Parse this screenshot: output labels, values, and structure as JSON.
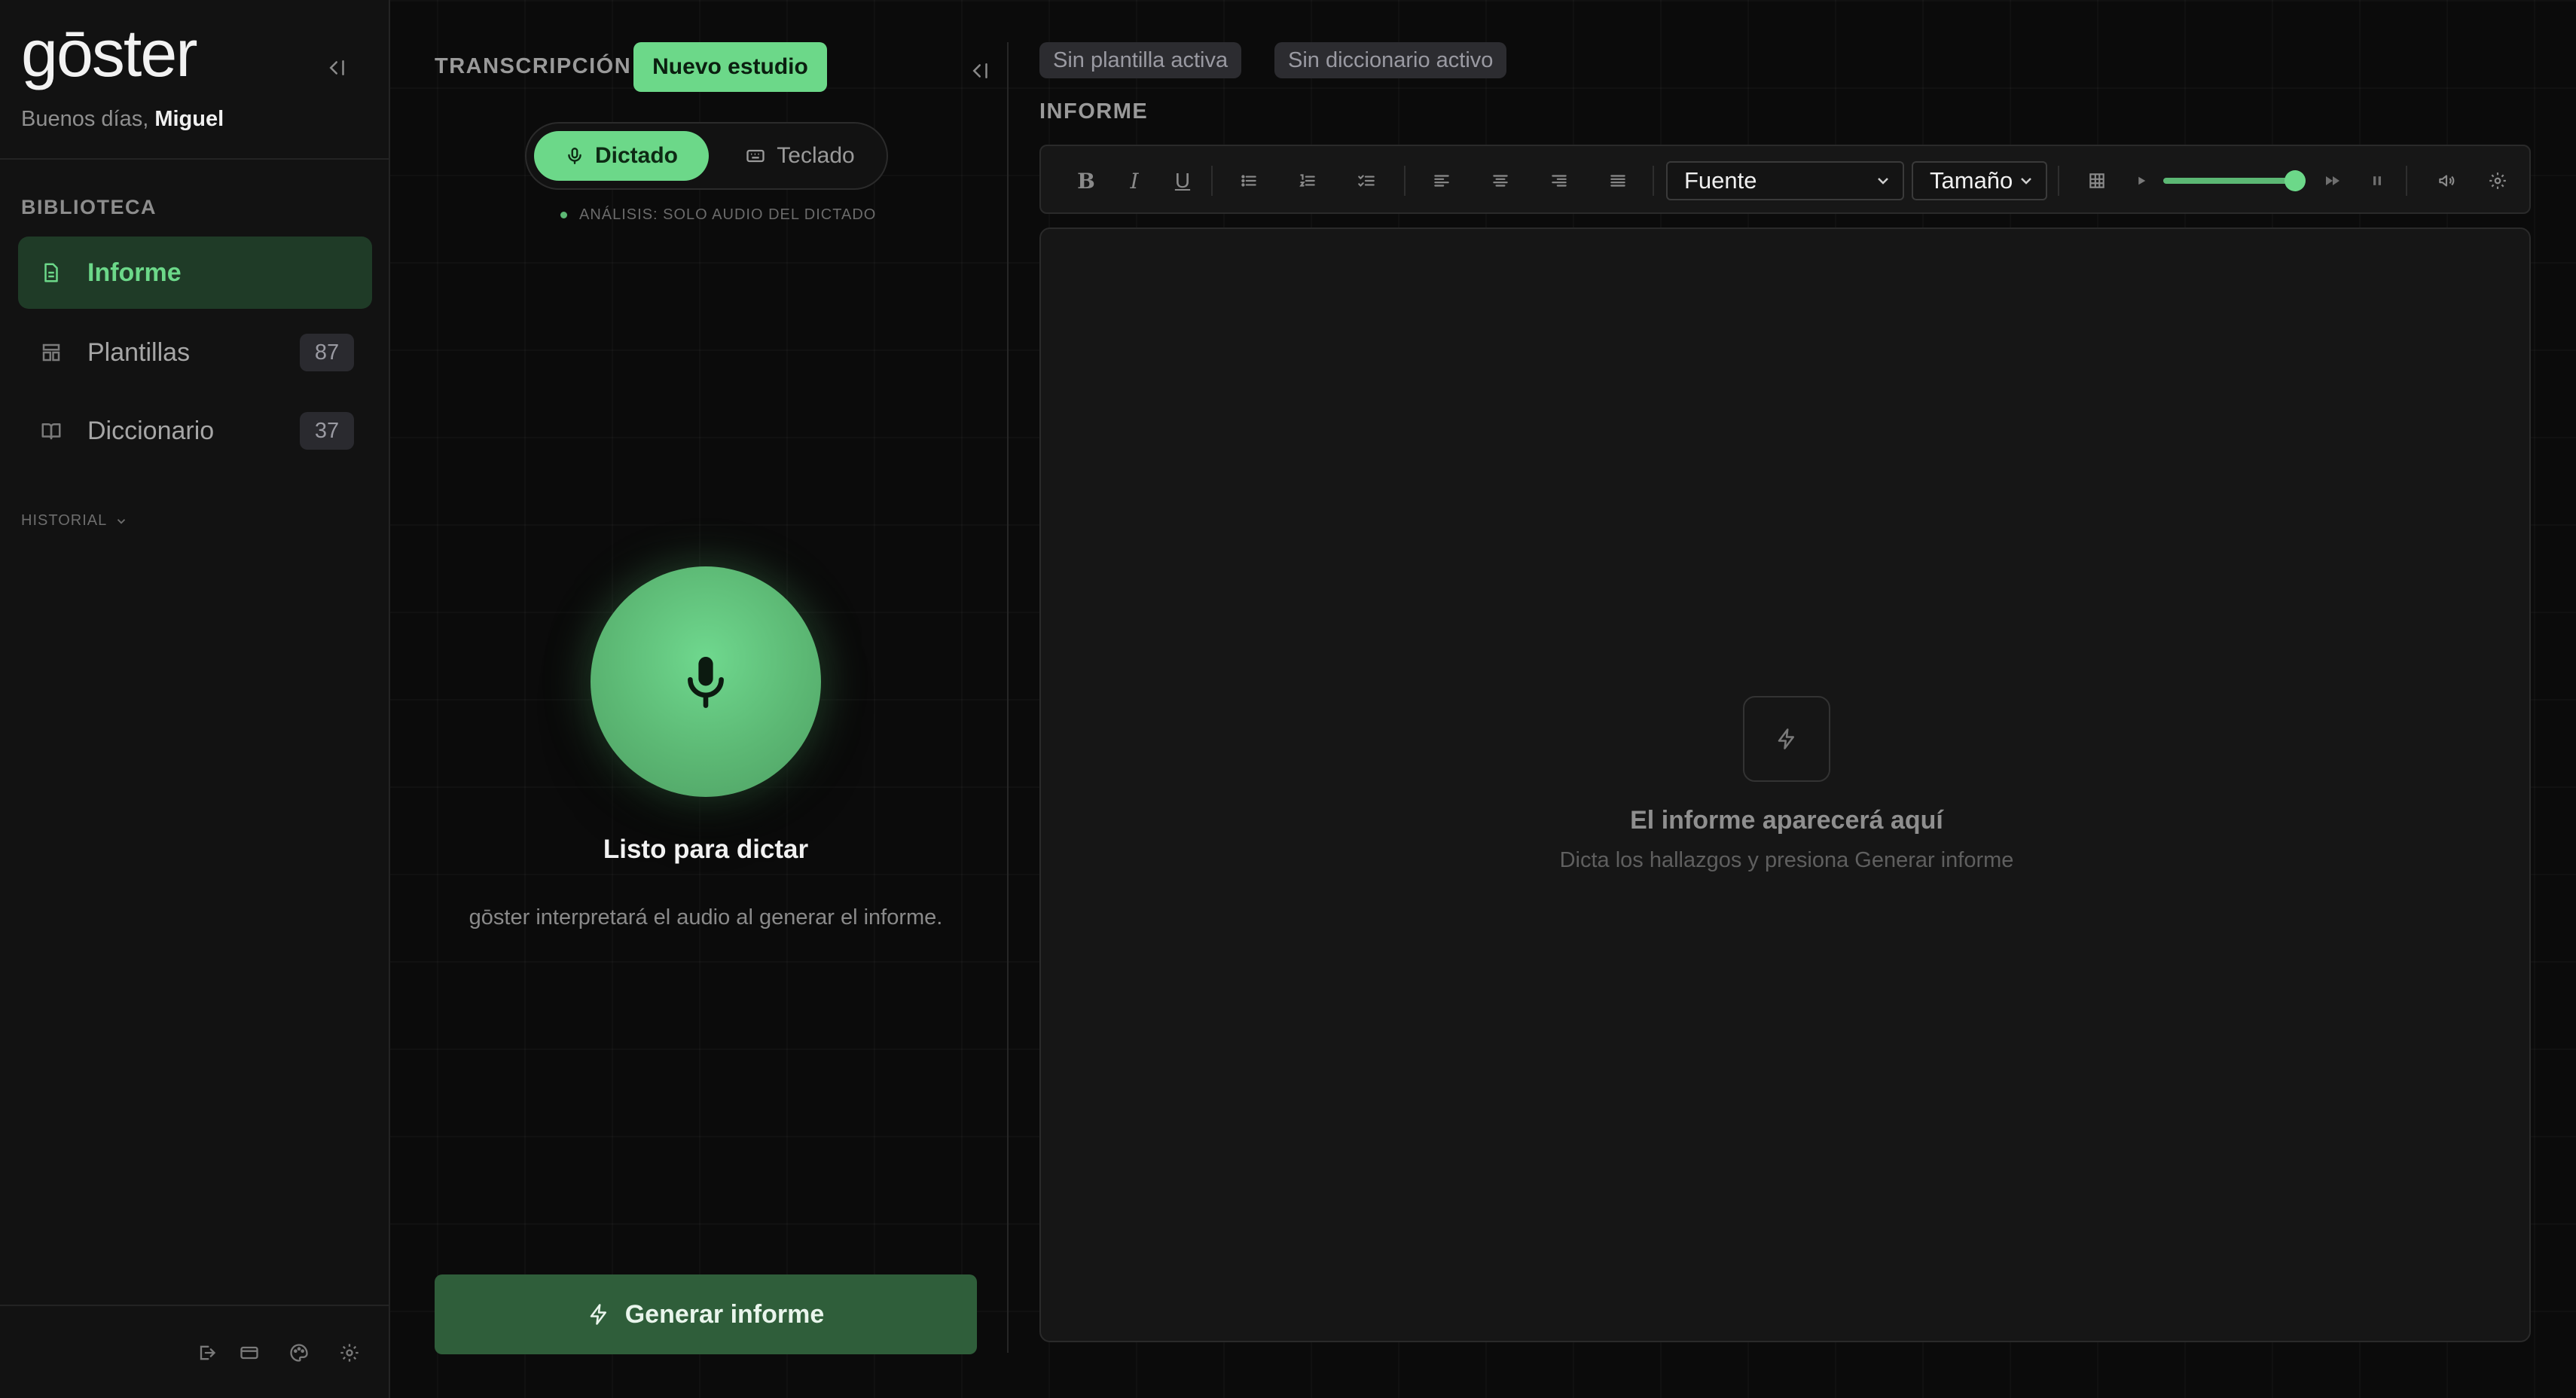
{
  "app": {
    "logo": "gōster",
    "greeting_prefix": "Buenos días, ",
    "user_name": "Miguel"
  },
  "sidebar": {
    "section_label": "BIBLIOTECA",
    "items": [
      {
        "label": "Informe",
        "icon": "document-icon",
        "active": true
      },
      {
        "label": "Plantillas",
        "icon": "template-icon",
        "count": "87"
      },
      {
        "label": "Diccionario",
        "icon": "book-icon",
        "count": "37"
      }
    ],
    "history_label": "HISTORIAL",
    "footer_icons": [
      "logout-icon",
      "credit-card-icon",
      "palette-icon",
      "gear-icon"
    ]
  },
  "transcription": {
    "title": "TRANSCRIPCIÓN",
    "new_study_label": "Nuevo estudio",
    "modes": [
      {
        "label": "Dictado",
        "icon": "mic-icon",
        "selected": true
      },
      {
        "label": "Teclado",
        "icon": "keyboard-icon",
        "selected": false
      }
    ],
    "analysis_note": "ANÁLISIS: SOLO AUDIO DEL DICTADO",
    "ready_text": "Listo para dictar",
    "hint_text": "gōster interpretará el audio al generar el informe.",
    "generate_label": "Generar informe"
  },
  "report": {
    "chips": [
      "Sin plantilla activa",
      "Sin diccionario activo"
    ],
    "title": "INFORME",
    "toolbar": {
      "bold": "B",
      "italic": "I",
      "underline": "U",
      "font_select": "Fuente",
      "size_select": "Tamaño",
      "playback_level": 0.92
    },
    "empty_title": "El informe aparecerá aquí",
    "empty_subtitle": "Dicta los hallazgos y presiona Generar informe"
  },
  "colors": {
    "accent": "#6cd889",
    "accent_dark": "#2f5e3a",
    "active_nav_bg": "#1f3b27",
    "background": "#0b0b0b",
    "panel": "#161616"
  }
}
